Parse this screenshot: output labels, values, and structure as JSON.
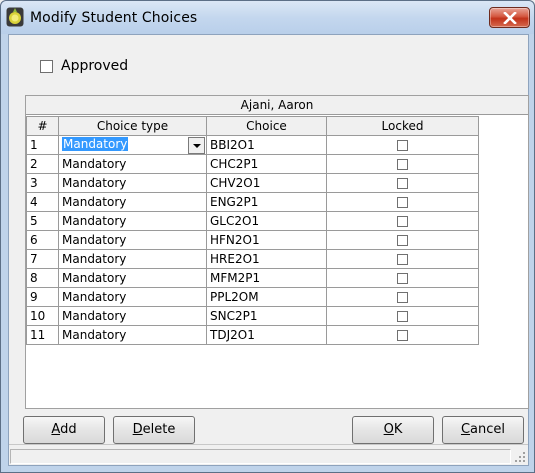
{
  "window": {
    "title": "Modify Student Choices"
  },
  "approved": {
    "label": "Approved",
    "checked": false
  },
  "grid": {
    "student_name": "Ajani, Aaron",
    "headers": {
      "num": "#",
      "choice_type": "Choice type",
      "choice": "Choice",
      "locked": "Locked"
    },
    "rows": [
      {
        "num": "1",
        "choice_type": "Mandatory",
        "choice": "BBI2O1",
        "locked": false
      },
      {
        "num": "2",
        "choice_type": "Mandatory",
        "choice": "CHC2P1",
        "locked": false
      },
      {
        "num": "3",
        "choice_type": "Mandatory",
        "choice": "CHV2O1",
        "locked": false
      },
      {
        "num": "4",
        "choice_type": "Mandatory",
        "choice": "ENG2P1",
        "locked": false
      },
      {
        "num": "5",
        "choice_type": "Mandatory",
        "choice": "GLC2O1",
        "locked": false
      },
      {
        "num": "6",
        "choice_type": "Mandatory",
        "choice": "HFN2O1",
        "locked": false
      },
      {
        "num": "7",
        "choice_type": "Mandatory",
        "choice": "HRE2O1",
        "locked": false
      },
      {
        "num": "8",
        "choice_type": "Mandatory",
        "choice": "MFM2P1",
        "locked": false
      },
      {
        "num": "9",
        "choice_type": "Mandatory",
        "choice": "PPL2OM",
        "locked": false
      },
      {
        "num": "10",
        "choice_type": "Mandatory",
        "choice": "SNC2P1",
        "locked": false
      },
      {
        "num": "11",
        "choice_type": "Mandatory",
        "choice": "TDJ2O1",
        "locked": false
      }
    ]
  },
  "buttons": {
    "add": {
      "mnemonic": "A",
      "rest": "dd"
    },
    "delete": {
      "mnemonic": "D",
      "rest": "elete"
    },
    "ok": {
      "mnemonic": "O",
      "rest": "K"
    },
    "cancel": {
      "mnemonic": "C",
      "rest": "ancel"
    }
  },
  "colors": {
    "selection": "#3399ff",
    "close_button": "#c2321a",
    "title_bar": "#c4d7ee"
  }
}
